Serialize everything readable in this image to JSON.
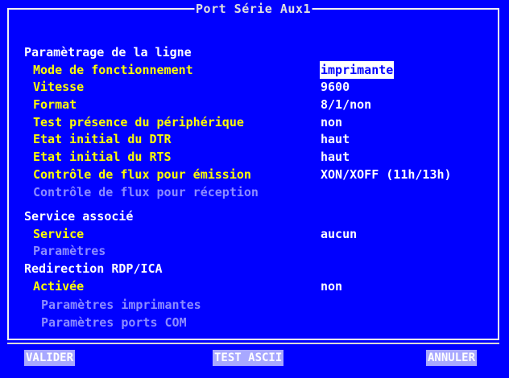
{
  "window": {
    "title": "Port Série Aux1"
  },
  "section_line": {
    "heading": "Paramètrage de la ligne",
    "items": [
      {
        "label": "Mode de fonctionnement",
        "value": "imprimante"
      },
      {
        "label": "Vitesse",
        "value": "9600"
      },
      {
        "label": "Format",
        "value": "8/1/non"
      },
      {
        "label": "Test présence du périphérique",
        "value": "non"
      },
      {
        "label": "Etat initial du DTR",
        "value": "haut"
      },
      {
        "label": "Etat initial du RTS",
        "value": "haut"
      },
      {
        "label": "Contrôle de flux pour émission",
        "value": "XON/XOFF (11h/13h)"
      },
      {
        "label": "Contrôle de flux pour réception"
      }
    ]
  },
  "section_service": {
    "heading": "Service associé",
    "items": [
      {
        "label": "Service",
        "value": "aucun"
      },
      {
        "label": "Paramètres"
      }
    ]
  },
  "section_redirect": {
    "heading": "Redirection RDP/ICA",
    "items": [
      {
        "label": "Activée",
        "value": "non"
      },
      {
        "label": "Paramètres imprimantes"
      },
      {
        "label": "Paramètres ports COM"
      }
    ]
  },
  "buttons": {
    "validate": "VALIDER",
    "test": "TEST ASCII",
    "cancel": "ANNULER"
  },
  "colors": {
    "background": "#0000ff",
    "heading": "#ffffff",
    "label": "#ffff00",
    "disabled": "#8c8cff",
    "button": "#a8a8ff"
  }
}
